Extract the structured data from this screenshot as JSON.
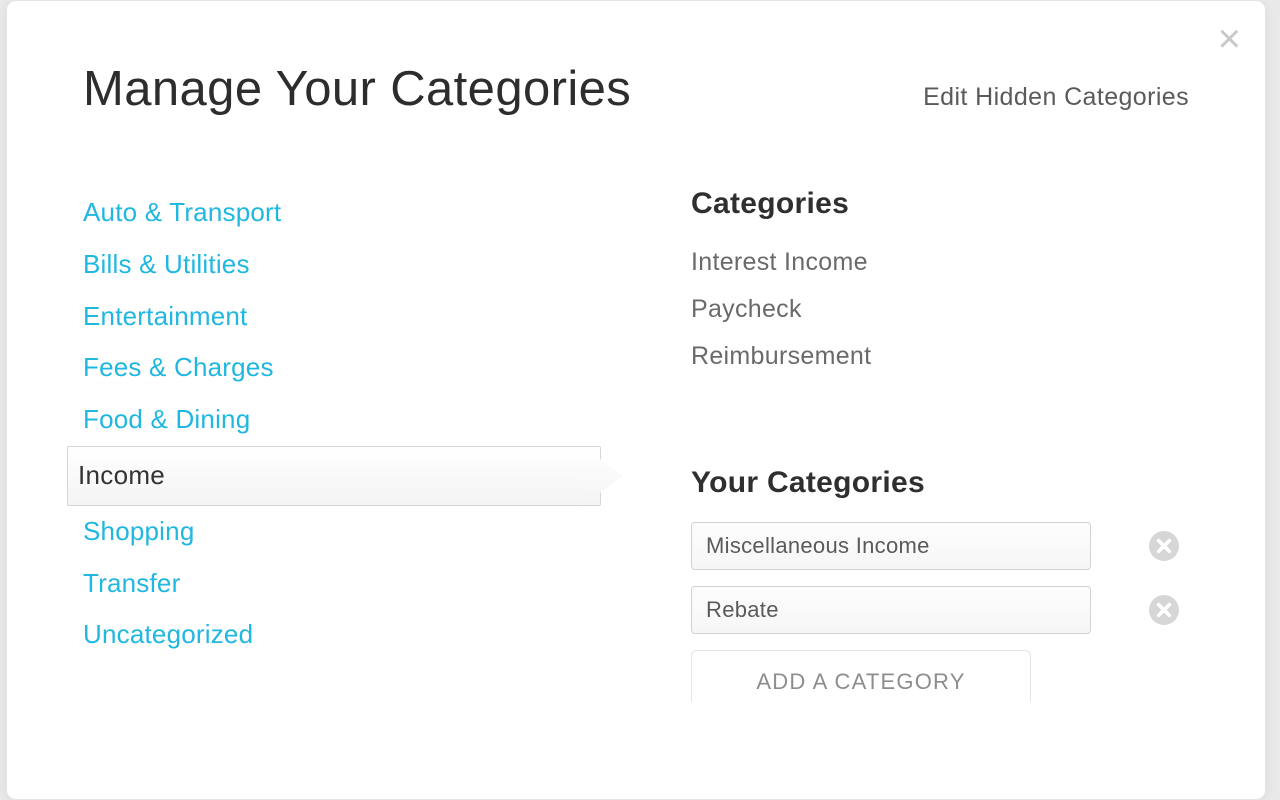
{
  "header": {
    "title": "Manage Your Categories",
    "edit_hidden": "Edit Hidden Categories",
    "close_glyph": "×"
  },
  "left": {
    "items": [
      {
        "label": "Auto & Transport",
        "selected": false
      },
      {
        "label": "Bills & Utilities",
        "selected": false
      },
      {
        "label": "Entertainment",
        "selected": false
      },
      {
        "label": "Fees & Charges",
        "selected": false
      },
      {
        "label": "Food & Dining",
        "selected": false
      },
      {
        "label": "Income",
        "selected": true
      },
      {
        "label": "Shopping",
        "selected": false
      },
      {
        "label": "Transfer",
        "selected": false
      },
      {
        "label": "Uncategorized",
        "selected": false
      }
    ]
  },
  "right": {
    "categories_heading": "Categories",
    "subcategories": [
      "Interest Income",
      "Paycheck",
      "Reimbursement"
    ],
    "your_categories_heading": "Your Categories",
    "your_categories": [
      "Miscellaneous Income",
      "Rebate"
    ],
    "add_button": "ADD A CATEGORY"
  }
}
